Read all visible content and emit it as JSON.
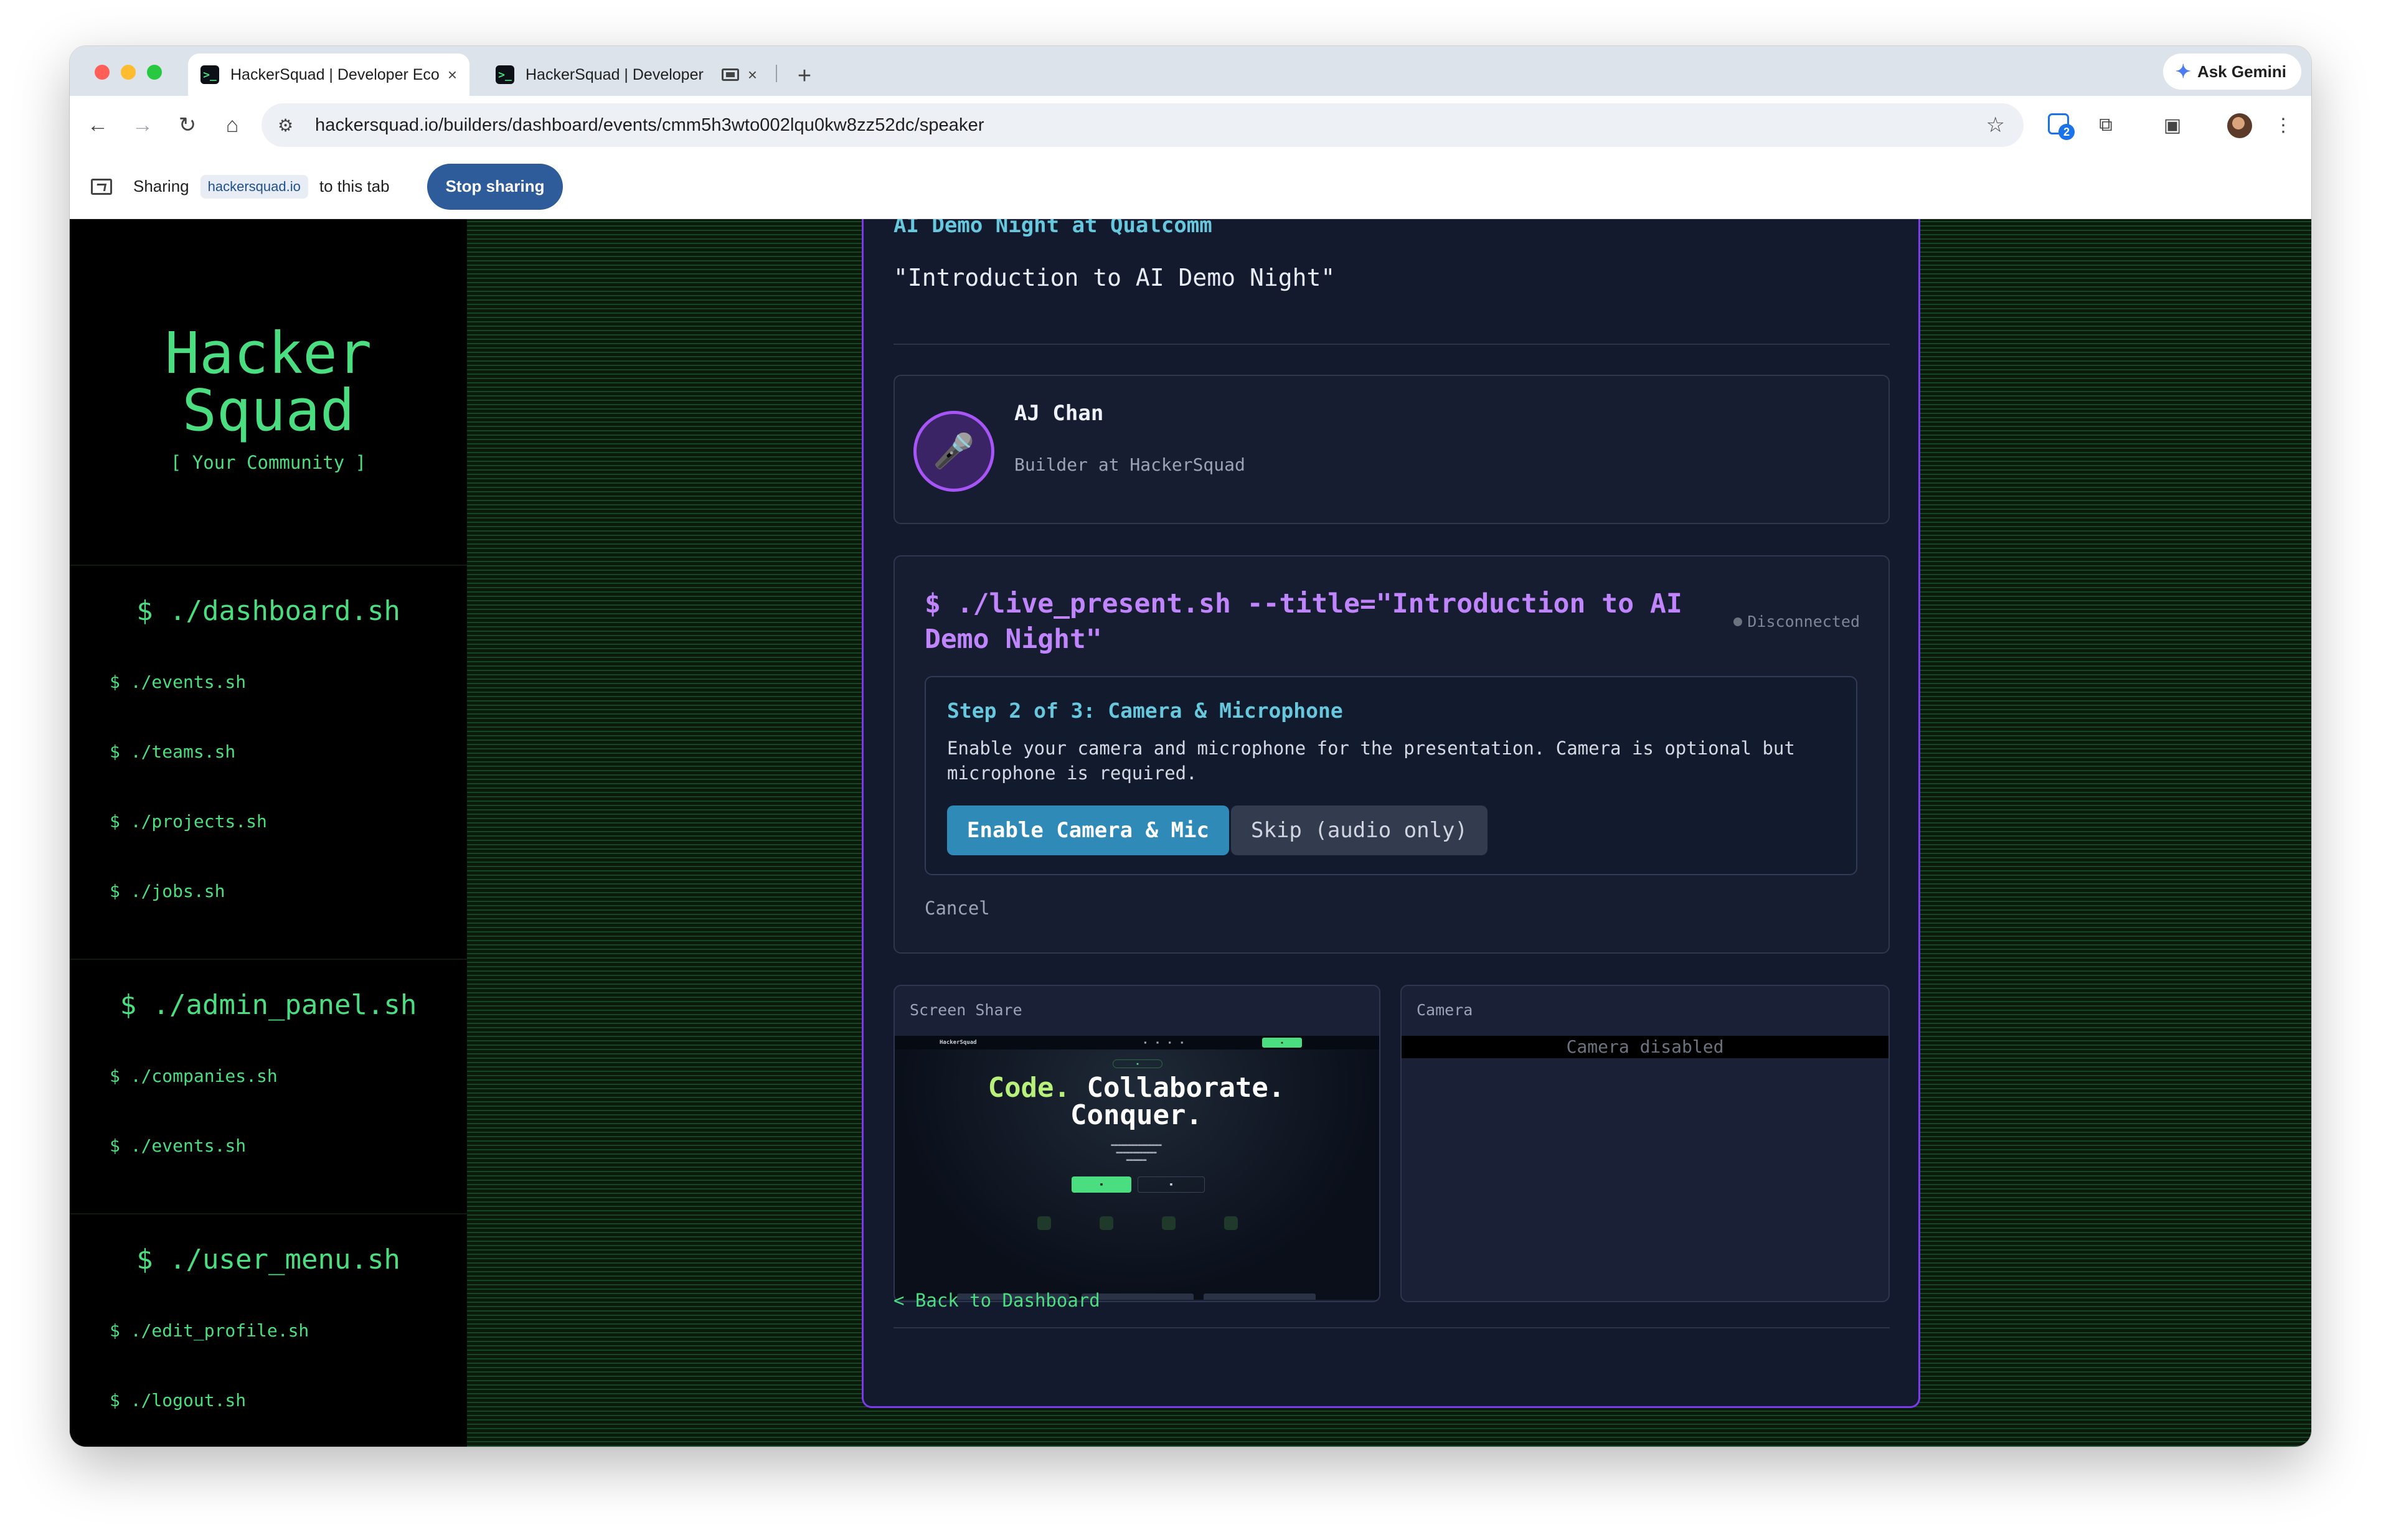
{
  "browser": {
    "tabs": [
      {
        "title": "HackerSquad | Developer Eco",
        "favicon": ">_"
      },
      {
        "title": "HackerSquad | Developer",
        "favicon": ">_"
      }
    ],
    "new_tab": "+",
    "close_glyph": "×",
    "ask_gemini": "Ask Gemini",
    "url": "hackersquad.io/builders/dashboard/events/cmm5h3wto002lqu0kw8zz52dc/speaker",
    "extension_badge_count": "2"
  },
  "sharing_bar": {
    "prefix": "Sharing",
    "domain": "hackersquad.io",
    "suffix": "to this tab",
    "stop_button": "Stop sharing"
  },
  "sidebar": {
    "logo_line1": "Hacker",
    "logo_line2": "Squad",
    "tagline": "[ Your Community ]",
    "sections": [
      {
        "heading": "$ ./dashboard.sh",
        "items": [
          "$ ./events.sh",
          "$ ./teams.sh",
          "$ ./projects.sh",
          "$ ./jobs.sh"
        ]
      },
      {
        "heading": "$ ./admin_panel.sh",
        "items": [
          "$ ./companies.sh",
          "$ ./events.sh"
        ]
      },
      {
        "heading": "$ ./user_menu.sh",
        "items": [
          "$ ./edit_profile.sh",
          "$ ./logout.sh"
        ]
      }
    ]
  },
  "event": {
    "name": "AI Demo Night at Qualcomm",
    "talk_title": "\"Introduction to AI Demo Night\""
  },
  "speaker": {
    "name": "AJ Chan",
    "role": "Builder at HackerSquad",
    "avatar_glyph": "🎤"
  },
  "live_present": {
    "command": "$ ./live_present.sh --title=\"Introduction to AI Demo Night\"",
    "status": "Disconnected",
    "step_title": "Step 2 of 3: Camera & Microphone",
    "step_description": "Enable your camera and microphone for the presentation. Camera is optional but microphone is required.",
    "enable_button": "Enable Camera & Mic",
    "skip_button": "Skip (audio only)",
    "cancel": "Cancel"
  },
  "previews": {
    "screen_share_label": "Screen Share",
    "camera_label": "Camera",
    "camera_disabled": "Camera disabled",
    "shared_page": {
      "logo": "HackerSquad",
      "headline_1": "Code.",
      "headline_2": "Collaborate.",
      "headline_3": "Conquer."
    }
  },
  "back_link": "< Back to Dashboard"
}
